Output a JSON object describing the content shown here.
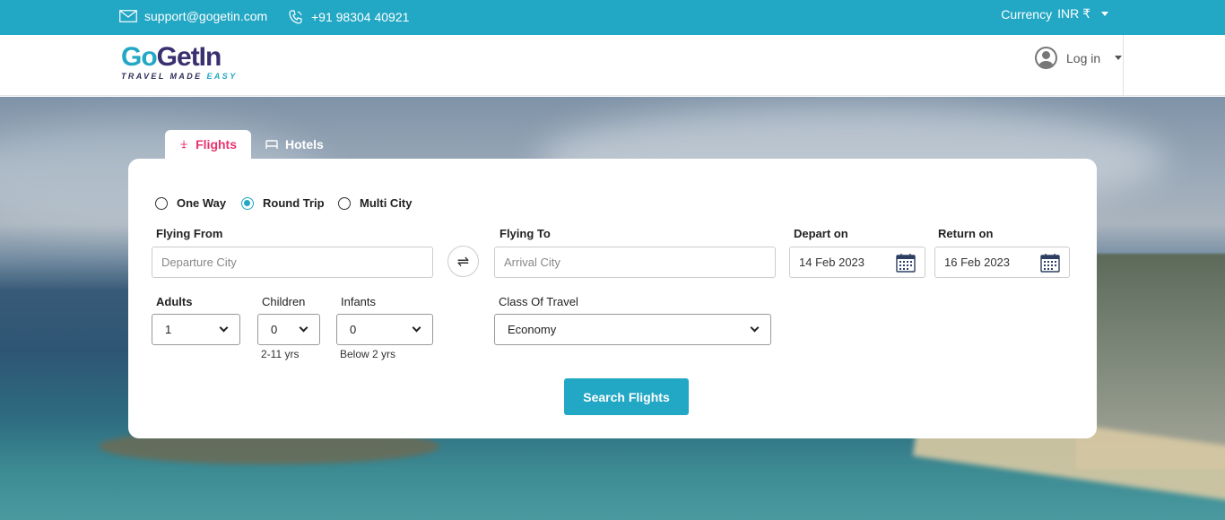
{
  "topbar": {
    "email": "support@gogetin.com",
    "phone": "+91 98304 40921",
    "currency_label": "Currency",
    "currency_value": "INR ₹"
  },
  "header": {
    "logo_go": "Go",
    "logo_getin": "GetIn",
    "logo_tag_main": "TRAVEL MADE ",
    "logo_tag_accent": "EASY",
    "login_label": "Log in"
  },
  "tabs": [
    {
      "label": "Flights",
      "icon": "airplane-icon",
      "active": true
    },
    {
      "label": "Hotels",
      "icon": "bed-icon",
      "active": false
    }
  ],
  "trip_types": [
    {
      "label": "One Way",
      "checked": false
    },
    {
      "label": "Round Trip",
      "checked": true
    },
    {
      "label": "Multi City",
      "checked": false
    }
  ],
  "form": {
    "flying_from_label": "Flying From",
    "flying_from_placeholder": "Departure City",
    "flying_to_label": "Flying To",
    "flying_to_placeholder": "Arrival City",
    "depart_label": "Depart on",
    "depart_value": "14 Feb 2023",
    "return_label": "Return on",
    "return_value": "16 Feb 2023",
    "adults_label": "Adults",
    "adults_value": "1",
    "children_label": "Children",
    "children_value": "0",
    "children_sub": "2-11 yrs",
    "infants_label": "Infants",
    "infants_value": "0",
    "infants_sub": "Below 2 yrs",
    "class_label": "Class Of Travel",
    "class_value": "Economy",
    "search_label": "Search Flights"
  },
  "colors": {
    "accent": "#22a7c4",
    "active_tab": "#e8336d"
  }
}
